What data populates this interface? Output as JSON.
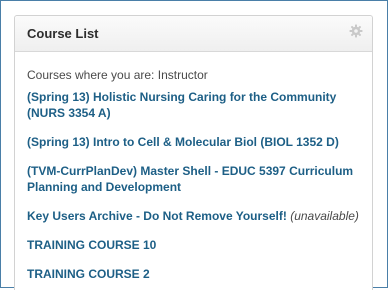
{
  "module": {
    "title": "Course List",
    "settings_icon": "gear-icon"
  },
  "intro": "Courses where you are: Instructor",
  "courses": [
    {
      "label": "(Spring 13) Holistic Nursing Caring for the Community (NURS 3354 A)"
    },
    {
      "label": "(Spring 13) Intro to Cell & Molecular Biol (BIOL 1352 D)"
    },
    {
      "label": "(TVM-CurrPlanDev) Master Shell - EDUC 5397 Curriculum Planning and Development"
    },
    {
      "label": "Key Users Archive - Do Not Remove Yourself!",
      "note": "(unavailable)"
    },
    {
      "label": "TRAINING COURSE 10"
    },
    {
      "label": "TRAINING COURSE 2"
    }
  ],
  "colors": {
    "link": "#1d5f86",
    "frame_border": "#4a7fa8"
  }
}
